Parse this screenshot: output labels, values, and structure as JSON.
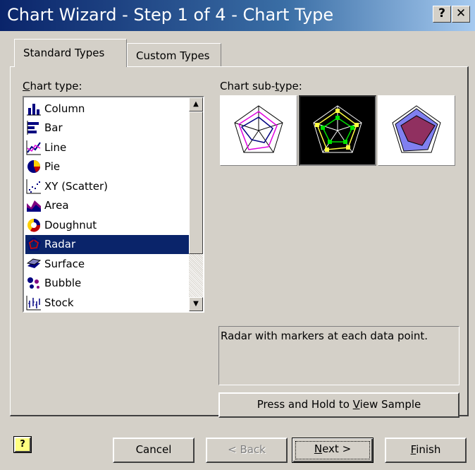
{
  "window": {
    "title": "Chart Wizard - Step 1 of 4 - Chart Type",
    "help_label": "?",
    "close_label": "✕"
  },
  "tabs": [
    {
      "label": "Standard Types",
      "active": true
    },
    {
      "label": "Custom Types",
      "active": false
    }
  ],
  "chart_type": {
    "label_prefix": "C",
    "label_rest": "hart type:",
    "items": [
      {
        "label": "Column",
        "icon": "column-chart-icon"
      },
      {
        "label": "Bar",
        "icon": "bar-chart-icon"
      },
      {
        "label": "Line",
        "icon": "line-chart-icon"
      },
      {
        "label": "Pie",
        "icon": "pie-chart-icon"
      },
      {
        "label": "XY (Scatter)",
        "icon": "scatter-chart-icon"
      },
      {
        "label": "Area",
        "icon": "area-chart-icon"
      },
      {
        "label": "Doughnut",
        "icon": "doughnut-chart-icon"
      },
      {
        "label": "Radar",
        "icon": "radar-chart-icon",
        "selected": true
      },
      {
        "label": "Surface",
        "icon": "surface-chart-icon"
      },
      {
        "label": "Bubble",
        "icon": "bubble-chart-icon"
      },
      {
        "label": "Stock",
        "icon": "stock-chart-icon"
      }
    ]
  },
  "subtype": {
    "label_a": "Chart sub-",
    "label_u": "t",
    "label_b": "ype:",
    "description": "Radar with markers at each data point.",
    "selected_index": 1
  },
  "sample_button": {
    "a": "Press and Hold to ",
    "u": "V",
    "b": "iew Sample"
  },
  "footer": {
    "cancel": "Cancel",
    "back": "< Back",
    "next_u": "N",
    "next_b": "ext >",
    "finish_u": "F",
    "finish_b": "inish",
    "office_help_icon": "?"
  }
}
